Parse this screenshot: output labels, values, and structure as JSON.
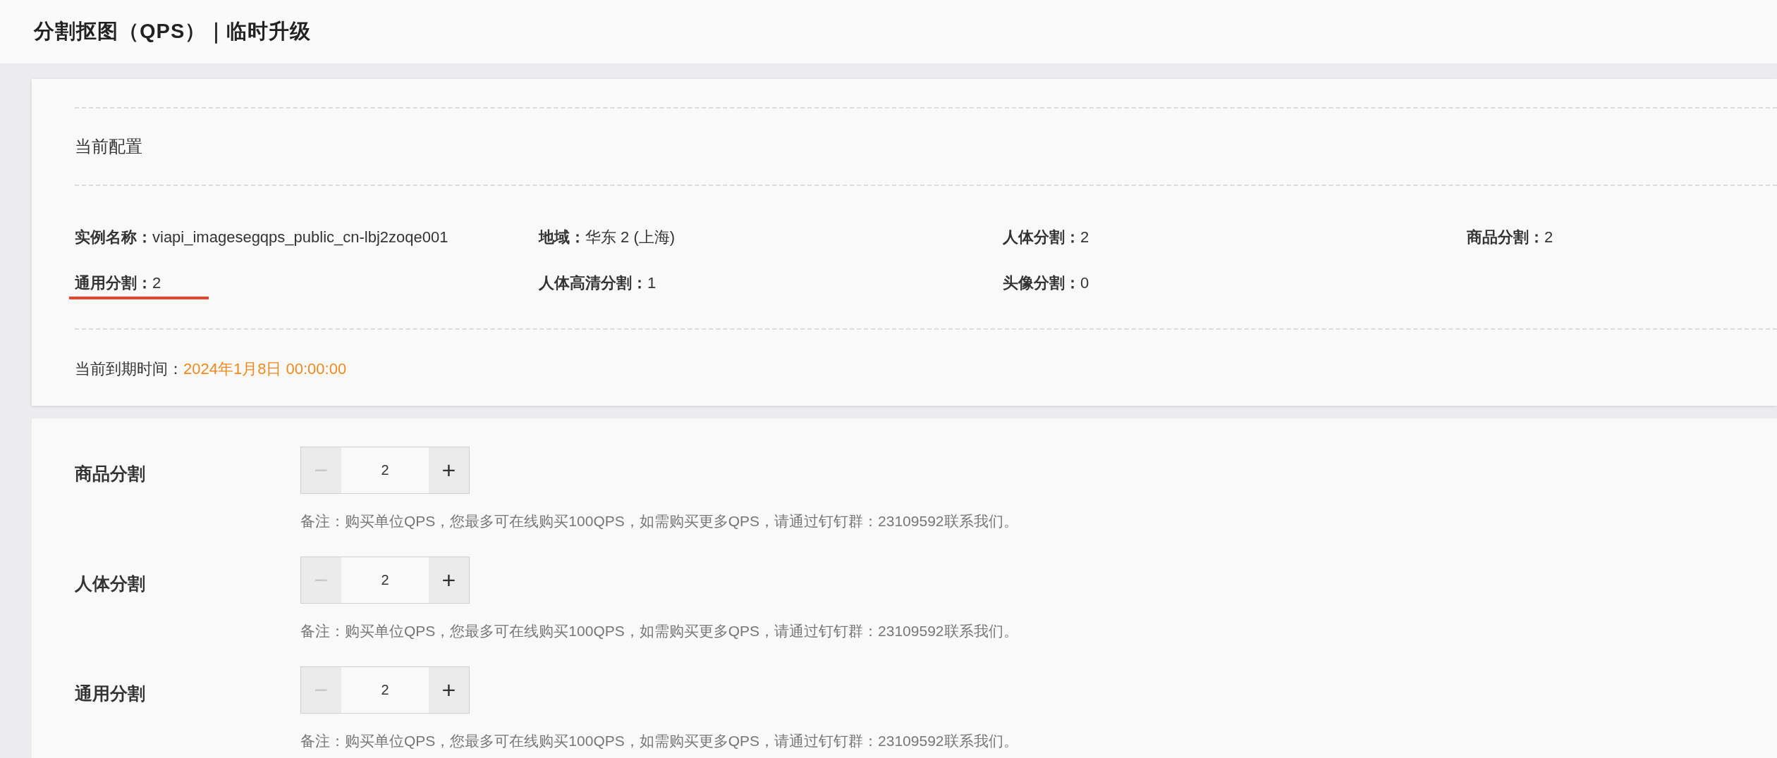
{
  "page_title": "分割抠图（QPS）｜临时升级",
  "current_config": {
    "heading": "当前配置",
    "fields": [
      {
        "label": "实例名称：",
        "value": "viapi_imagesegqps_public_cn-lbj2zoqe001",
        "highlighted": false
      },
      {
        "label": "地域：",
        "value": "华东 2 (上海)",
        "highlighted": false
      },
      {
        "label": "人体分割：",
        "value": "2",
        "highlighted": false
      },
      {
        "label": "商品分割：",
        "value": "2",
        "highlighted": false
      },
      {
        "label": "通用分割：",
        "value": "2",
        "highlighted": true
      },
      {
        "label": "人体高清分割：",
        "value": "1",
        "highlighted": false
      },
      {
        "label": "头像分割：",
        "value": "0",
        "highlighted": false
      }
    ],
    "expiry_label": "当前到期时间：",
    "expiry_value": "2024年1月8日 00:00:00"
  },
  "quantities": [
    {
      "label": "商品分割",
      "value": "2",
      "minus": "−",
      "plus": "+",
      "minus_disabled": true,
      "note": "备注：购买单位QPS，您最多可在线购买100QPS，如需购买更多QPS，请通过钉钉群：23109592联系我们。"
    },
    {
      "label": "人体分割",
      "value": "2",
      "minus": "−",
      "plus": "+",
      "minus_disabled": true,
      "note": "备注：购买单位QPS，您最多可在线购买100QPS，如需购买更多QPS，请通过钉钉群：23109592联系我们。"
    },
    {
      "label": "通用分割",
      "value": "2",
      "minus": "−",
      "plus": "+",
      "minus_disabled": true,
      "note": "备注：购买单位QPS，您最多可在线购买100QPS，如需购买更多QPS，请通过钉钉群：23109592联系我们。"
    }
  ]
}
